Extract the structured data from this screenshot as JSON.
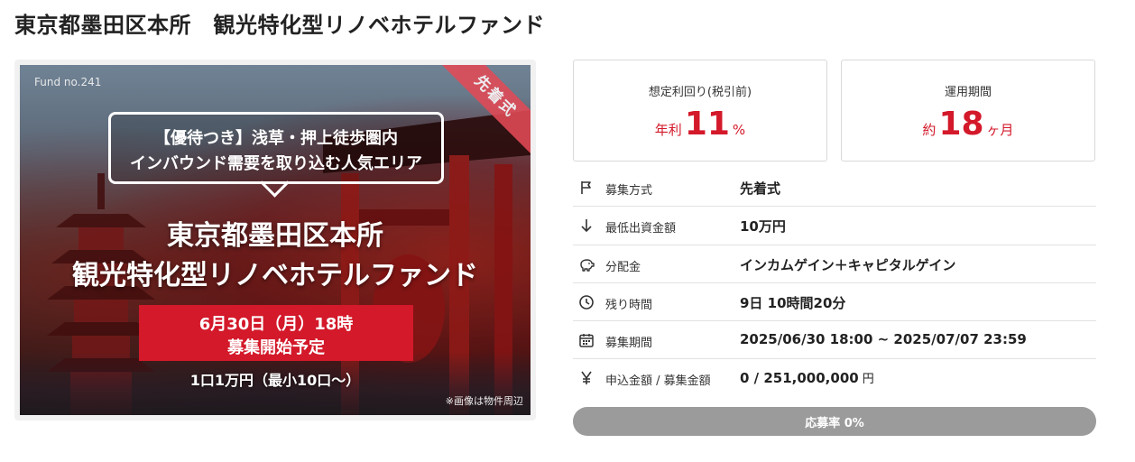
{
  "page_title": "東京都墨田区本所　観光特化型リノベホテルファンド",
  "hero": {
    "fund_no": "Fund no.241",
    "ribbon": "先着式",
    "callout_line1": "【優待つき】浅草・押上徒歩圏内",
    "callout_line2": "インバウンド需要を取り込む人気エリア",
    "title_line1": "東京都墨田区本所",
    "title_line2": "観光特化型リノベホテルファンド",
    "date_line1": "6月30日（月）18時",
    "date_line2": "募集開始予定",
    "unit_note": "1口1万円（最小10口〜）",
    "image_note": "※画像は物件周辺"
  },
  "stats": {
    "yield": {
      "label": "想定利回り(税引前)",
      "prefix": "年利",
      "value": "11",
      "suffix": "%"
    },
    "period": {
      "label": "運用期間",
      "prefix": "約",
      "value": "18",
      "suffix": "ヶ月"
    }
  },
  "info_rows": [
    {
      "icon": "flag-icon",
      "label": "募集方式",
      "value": "先着式",
      "unit": ""
    },
    {
      "icon": "arrow-down-icon",
      "label": "最低出資金額",
      "value": "10万円",
      "unit": ""
    },
    {
      "icon": "piggy-bank-icon",
      "label": "分配金",
      "value": "インカムゲイン＋キャピタルゲイン",
      "unit": ""
    },
    {
      "icon": "clock-icon",
      "label": "残り時間",
      "value": "9日 10時間20分",
      "unit": ""
    },
    {
      "icon": "calendar-icon",
      "label": "募集期間",
      "value": "2025/06/30 18:00 ~ 2025/07/07 23:59",
      "unit": ""
    },
    {
      "icon": "yen-icon",
      "label": "申込金額 / 募集金額",
      "value": "0 / 251,000,000",
      "unit": "円"
    }
  ],
  "progress": {
    "label": "応募率 0%",
    "percent": 0
  },
  "colors": {
    "accent": "#d3192a",
    "ribbon": "#e24a56",
    "progress_track": "#9b9b9b"
  }
}
